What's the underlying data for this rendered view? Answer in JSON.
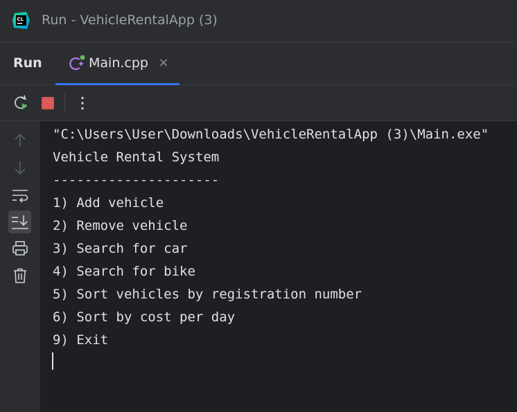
{
  "window": {
    "title": "Run - VehicleRentalApp (3)",
    "logo_text": "CL"
  },
  "tabbar": {
    "run_label": "Run",
    "tabs": [
      {
        "label": "Main.cpp",
        "close_glyph": "×",
        "active": true,
        "icon": "cpp-file-icon"
      }
    ]
  },
  "toolbar": {
    "buttons": [
      {
        "name": "rerun-button",
        "icon": "rerun-icon"
      },
      {
        "name": "stop-button",
        "icon": "stop-icon",
        "color": "#db5c5c"
      },
      {
        "name": "more-button",
        "icon": "kebab-menu-icon"
      }
    ]
  },
  "sidebar": {
    "buttons": [
      {
        "name": "scroll-up-button",
        "icon": "arrow-up-icon"
      },
      {
        "name": "scroll-down-button",
        "icon": "arrow-down-icon"
      },
      {
        "name": "soft-wrap-button",
        "icon": "soft-wrap-icon"
      },
      {
        "name": "scroll-to-end-button",
        "icon": "scroll-to-end-icon",
        "active": true
      },
      {
        "name": "print-button",
        "icon": "printer-icon"
      },
      {
        "name": "clear-button",
        "icon": "trash-icon"
      }
    ]
  },
  "console": {
    "lines": [
      "\"C:\\Users\\User\\Downloads\\VehicleRentalApp (3)\\Main.exe\"",
      "Vehicle Rental System",
      "---------------------",
      "1) Add vehicle",
      "2) Remove vehicle",
      "3) Search for car",
      "4) Search for bike",
      "5) Sort vehicles by registration number",
      "6) Sort by cost per day",
      "9) Exit"
    ]
  },
  "colors": {
    "accent": "#3574f0",
    "background": "#1e1f22",
    "panel": "#2b2d30",
    "stop": "#db5c5c",
    "run_badge": "#5fb865"
  }
}
